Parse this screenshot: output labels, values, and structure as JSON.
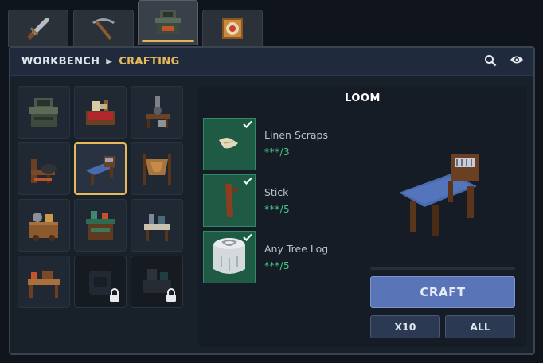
{
  "tabs": [
    {
      "icon": "sword-icon",
      "active": false
    },
    {
      "icon": "pickaxe-icon",
      "active": false
    },
    {
      "icon": "workbench-icon",
      "active": true
    },
    {
      "icon": "target-icon",
      "active": false
    }
  ],
  "header": {
    "breadcrumb_root": "WORKBENCH",
    "breadcrumb_current": "CRAFTING",
    "search_icon": "search-icon",
    "visibility_icon": "eye-icon"
  },
  "recipes": [
    {
      "icon": "workbench-icon",
      "locked": false,
      "selected": false
    },
    {
      "icon": "tailoring-table-icon",
      "locked": false,
      "selected": false
    },
    {
      "icon": "tool-bench-icon",
      "locked": false,
      "selected": false
    },
    {
      "icon": "chair-forge-icon",
      "locked": false,
      "selected": false
    },
    {
      "icon": "loom-icon",
      "locked": false,
      "selected": true
    },
    {
      "icon": "tanning-rack-icon",
      "locked": false,
      "selected": false
    },
    {
      "icon": "cooking-station-icon",
      "locked": false,
      "selected": false
    },
    {
      "icon": "herbalist-table-icon",
      "locked": false,
      "selected": false
    },
    {
      "icon": "alchemy-table-icon",
      "locked": false,
      "selected": false
    },
    {
      "icon": "carpentry-bench-icon",
      "locked": false,
      "selected": false
    },
    {
      "icon": "furnace-icon",
      "locked": true,
      "selected": false
    },
    {
      "icon": "machine-bench-icon",
      "locked": true,
      "selected": false
    }
  ],
  "detail": {
    "title": "LOOM",
    "ingredients": [
      {
        "name": "Linen Scraps",
        "qty": "***/3",
        "icon": "linen-scraps-icon",
        "ready": true
      },
      {
        "name": "Stick",
        "qty": "***/5",
        "icon": "stick-icon",
        "ready": true
      },
      {
        "name": "Any Tree Log",
        "qty": "***/5",
        "icon": "tree-log-icon",
        "ready": true
      }
    ],
    "preview_icon": "loom-icon"
  },
  "actions": {
    "craft_label": "CRAFT",
    "x10_label": "X10",
    "all_label": "ALL"
  },
  "colors": {
    "accent": "#e7b95c",
    "craft_button": "#5a74b8",
    "ingredient_ready": "#1e5a44",
    "quantity_text": "#45c98a"
  }
}
